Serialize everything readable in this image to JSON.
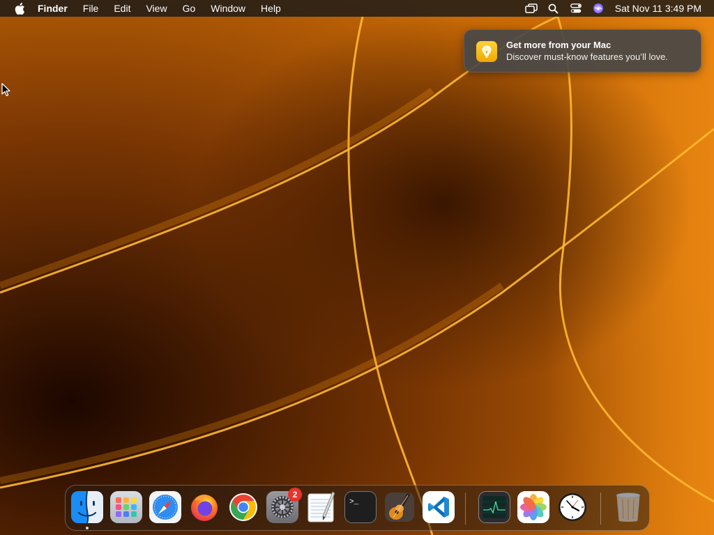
{
  "menubar": {
    "app_name": "Finder",
    "menus": [
      "File",
      "Edit",
      "View",
      "Go",
      "Window",
      "Help"
    ],
    "clock": "Sat Nov 11  3:49 PM",
    "status_icons": [
      "screen-mirroring-icon",
      "spotlight-search-icon",
      "control-center-icon",
      "siri-icon"
    ]
  },
  "notification": {
    "title": "Get more from your Mac",
    "body": "Discover must-know features you’ll love.",
    "icon": "lightbulb-icon"
  },
  "dock": {
    "apps": [
      {
        "name": "Finder",
        "icon": "finder-icon",
        "running": true
      },
      {
        "name": "Launchpad",
        "icon": "launchpad-icon"
      },
      {
        "name": "Safari",
        "icon": "safari-icon"
      },
      {
        "name": "Firefox",
        "icon": "firefox-icon"
      },
      {
        "name": "Google Chrome",
        "icon": "chrome-icon"
      },
      {
        "name": "System Settings",
        "icon": "system-settings-icon",
        "badge": "2"
      },
      {
        "name": "TextEdit",
        "icon": "textedit-icon"
      },
      {
        "name": "Terminal",
        "icon": "terminal-icon"
      },
      {
        "name": "GarageBand",
        "icon": "garageband-icon"
      },
      {
        "name": "Visual Studio Code",
        "icon": "vscode-icon"
      },
      {
        "name": "Activity Monitor",
        "icon": "activity-monitor-icon"
      },
      {
        "name": "Photos",
        "icon": "photos-icon"
      },
      {
        "name": "Clock",
        "icon": "clock-icon"
      },
      {
        "name": "Trash",
        "icon": "trash-icon"
      }
    ]
  },
  "colors": {
    "wallpaper_dark": "#2a0f00",
    "wallpaper_orange": "#e8860c",
    "badge_red": "#e8352b"
  }
}
